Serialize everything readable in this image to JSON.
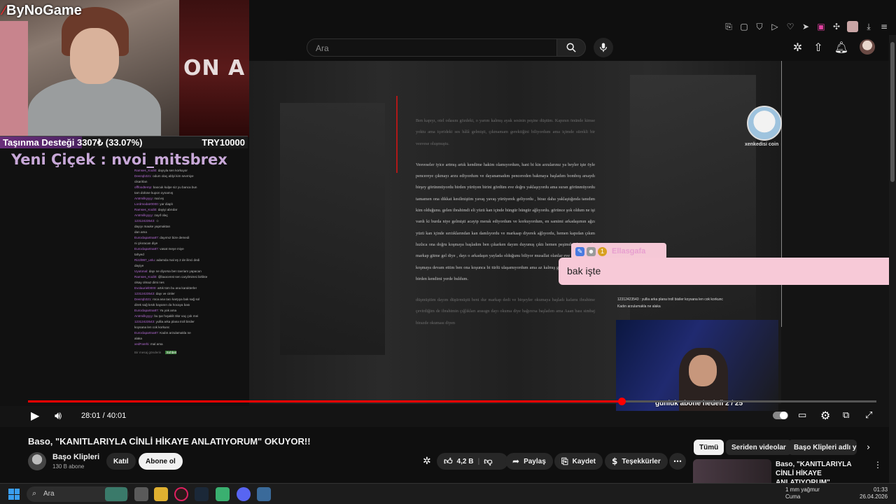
{
  "stream_overlay": {
    "logo": "ByNoGame",
    "poster_text": "ON A",
    "donation_label": "Taşınma Desteği 3307₺ (33.07%)",
    "donation_goal": "TRY10000",
    "donation_progress": 0.3307,
    "flower_alert": "Yeni Çiçek : nvoi_mitsbrex",
    "sub_goal": "günlük abone hedefi 2 / 25",
    "cat_avatar_name": "xenkedisi coin",
    "alert_user": "Ellasgafa",
    "alert_message": "bak işte",
    "chat_line_1": "12312423543 : yullia arka plana troll bisiler koysana len cok korkunc",
    "chat_line_2": "Kadın arzulamakla ne alaka"
  },
  "mini_chat": [
    {
      "user": "Ramses_Kodi0:",
      "text": "dayıyla sen korkuyor"
    },
    {
      "user": "Deezqb321:",
      "text": "odum olaç ablyi kim sevmiye"
    },
    {
      "user": "",
      "text": "cikarirlan"
    },
    {
      "user": "offfoodtemp:",
      "text": "baocuk kulpe siz yu banca bun"
    },
    {
      "user": "",
      "text": "tam dolüne kupon oynamış"
    },
    {
      "user": "Antrmilkyyyy:",
      "text": "mal eş"
    },
    {
      "user": "Lordmodatr0000:",
      "text": "yar diaplı"
    },
    {
      "user": "Ramses_Kodi0:",
      "text": "dayiyi abrıdar"
    },
    {
      "user": "Antrmilkyyyy:",
      "text": "zayıf olaç"
    },
    {
      "user": "12312423543:",
      "text": "☺"
    },
    {
      "user": "",
      "text": "dayıyı mauke yapmaktan"
    },
    {
      "user": "",
      "text": "dan ama"
    },
    {
      "user": "Euroclapartna87:",
      "text": "dayımız bize demedi"
    },
    {
      "user": "",
      "text": "ni çıkıracan diye"
    },
    {
      "user": "Euroclapartna87:",
      "text": "vasat meye miye"
    },
    {
      "user": "",
      "text": "tahyed"
    },
    {
      "user": "Rizzl997_unlu:",
      "text": "adamda mal eş 2 de ilinci dedi"
    },
    {
      "user": "",
      "text": "dayiye"
    },
    {
      "user": "Uyutonal:",
      "text": "dayı ne diyorsa ben tavriam yapacan"
    },
    {
      "user": "Ramses_Kodi0:",
      "text": "@baocenst sen caryilmimsi birlikte"
    },
    {
      "user": "",
      "text": "olsay olmaz dimi nes"
    },
    {
      "user": "Evolauriel0000:",
      "text": "artık tüm bu ana karakterler"
    },
    {
      "user": "12312423543:",
      "text": "dayı ve cinler"
    },
    {
      "user": "Deezqb321:",
      "text": "roca ana tacı karşıya bak sağ sol"
    },
    {
      "user": "",
      "text": "direk sağ kısık bayanın da hocaya bası"
    },
    {
      "user": "Euroclapartna87:",
      "text": "Ya yok ama"
    },
    {
      "user": "Antrmilkyyyy:",
      "text": "bu şar hışaklit ölür vaç çok mei"
    },
    {
      "user": "12312423543:",
      "text": "yullia arka plana troll bisiler"
    },
    {
      "user": "",
      "text": "koysana len cok korkunc"
    },
    {
      "user": "Euroclapartna87:",
      "text": "Kadın arzulamakla ne"
    },
    {
      "user": "",
      "text": "alaka"
    },
    {
      "user": "xedFarehi:",
      "text": "mal ama"
    }
  ],
  "mini_chat_input": {
    "placeholder": "Bir mesaj gönderin",
    "send": "Sohbet"
  },
  "book_text": {
    "p1": "Ben kapıyı, otel odasını gözdeki, o yarım kalmış ayak sesinin peşine düştüm. Kapının önünde kimse yoktu ama içerideki ses hâlâ gelmişti, çıkmamam gerektiğini biliyordum ama içimde sürekli bir vesvese oluşmuştu.",
    "p2": "Vesveseler iyice artmış artık kendime hakim olamıyordum, hani bi kin arzularınız ya beyler işte öyle pencereye çıkmayı arzu ediyordum ve dayanamadım pencereden bakmaya başladım bomboş arsaydı birşey görünmüyordu birden yürüyen birini gördüm eve doğru yaklaşıyordu ama suran görünmüyordu tamamen ona dikkat kesilmiştim yavaş yavaş yürüyerek geliyordu , biraz daha yaklaştığında tanıdım kim olduğunu. gelen ibrahimdi eli yüzü kan içinde hüngür hüngür ağlıyordu. görünce şok oldum ne işi vardı ki burda niye gelmişti acayip merak ediyordum ve korkuyordum, en samimi arkadaşımın ağzı yüzü kan içinde sırıtıklarından kan damlıyordu ve markaap diyerek ağlıyordu, hemen kapıdan çıkım hızlıca ona doğru koşmaya başladım ben çıkarken dayım duyunuş çıktı hemen peşimden koşuyordu markap gitme gel diye , dayı o arkadaşın yaylada olduğunu biliyor musallat olanlar eve sokalım diyip koşmaya devam ettim ben ona koşunca bi türlü ulaşamıyordum ama az kalmış gibi hissediyordum ki birden kendimi yerde buldum.",
    "p3": "düşmüştüm dayım düşürmüştü beni dur markap dedi ve birşeyler okumaya başladı kafamı ibrahime çevirdiğim de ibrahimin çığlıkları arasıgn dayı okuma diye bağırırsa başladım ama Aaan bası simbaj birazde okuması diyen"
  },
  "browser": {
    "search_placeholder": "Ara"
  },
  "player": {
    "current_time": "28:01",
    "duration": "40:01",
    "time_display": "28:01 / 40:01",
    "progress": 0.7
  },
  "video": {
    "title": "Baso, \"KANITLARIYLA CİNLİ HİKAYE ANLATIYORUM\" OKUYOR!!",
    "channel": "Başo Klipleri",
    "subscribers": "130 B abone",
    "join": "Katıl",
    "subscribe": "Abone ol",
    "likes": "4,2 B",
    "share": "Paylaş",
    "save": "Kaydet",
    "thanks": "Teşekkürler"
  },
  "recommendations": {
    "chips": [
      "Tümü",
      "Seriden videolar",
      "Başo Klipleri adlı yükleyiciden"
    ],
    "rec_title": "Baso, \"KANITLARIYLA CİNLİ HİKAYE ANLATIYORUM\" ..."
  },
  "taskbar": {
    "search": "Ara",
    "weather": "1 mm yağmur",
    "weather_sub": "Cuma",
    "time": "01:33",
    "date": "26.04.2026"
  },
  "colors": {
    "accent": "#ff0000",
    "background": "#0f0f0f",
    "alert_pink": "#f7c9d7",
    "donation_purple": "#6a2f7a"
  }
}
